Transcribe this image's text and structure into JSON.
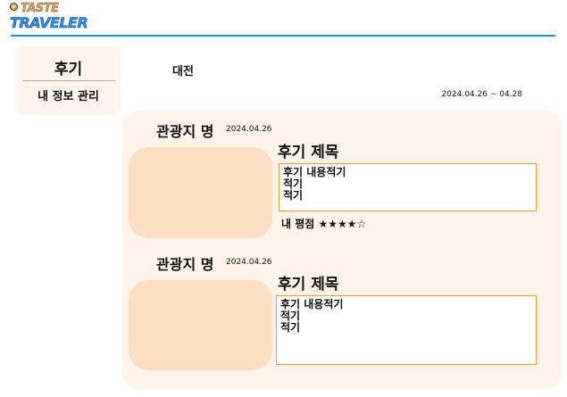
{
  "brand": {
    "line1": "TASTE",
    "line2": "TRAVELER"
  },
  "sidebar": {
    "title": "후기",
    "items": [
      {
        "label": "내 정보 관리"
      }
    ]
  },
  "header": {
    "region": "대전",
    "date_range": "2024.04.26 ~ 04.28"
  },
  "reviews": [
    {
      "place": "관광지 명",
      "date": "2024.04.26",
      "title": "후기 제목",
      "content": [
        "후기 내용적기",
        "적기",
        "적기"
      ],
      "rating_label": "내 평점",
      "rating_stars": "★★★★☆",
      "rating_value": 4,
      "rating_max": 5
    },
    {
      "place": "관광지 명",
      "date": "2024.04.26",
      "title": "후기 제목",
      "content": [
        "후기 내용적기",
        "적기",
        "적기"
      ]
    }
  ],
  "colors": {
    "accent_blue": "#1e90e8",
    "accent_orange": "#f29a2b",
    "card_bg": "#fef4ea",
    "photo_bg": "#fde0c4"
  }
}
